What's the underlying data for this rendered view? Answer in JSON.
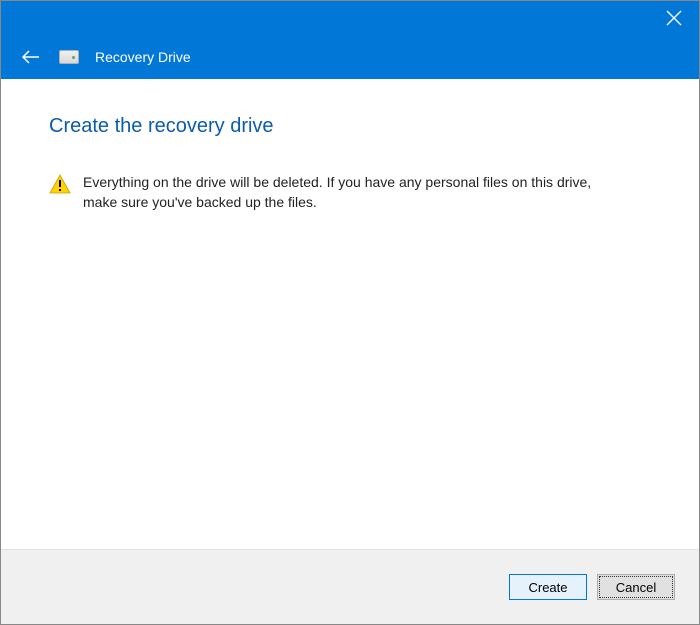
{
  "titlebar": {
    "app_name": "Recovery Drive"
  },
  "main": {
    "heading": "Create the recovery drive",
    "warning_text": "Everything on the drive will be deleted. If you have any personal files on this drive, make sure you've backed up the files."
  },
  "footer": {
    "create_label": "Create",
    "cancel_label": "Cancel"
  },
  "colors": {
    "accent": "#0178d7",
    "heading": "#0b5cad"
  }
}
